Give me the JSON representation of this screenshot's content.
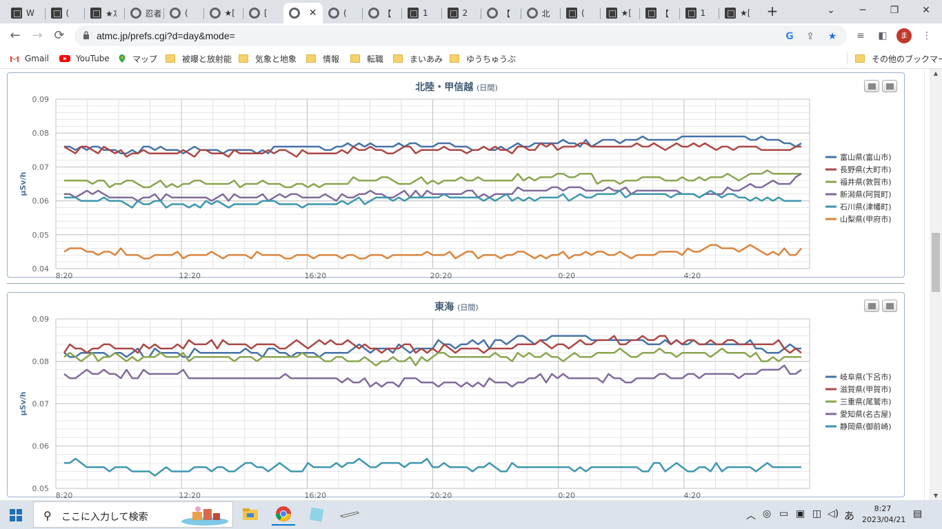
{
  "browser": {
    "tabs": [
      {
        "label": "W",
        "favicon": "site-square-icon"
      },
      {
        "label": "(",
        "favicon": "site-square-icon"
      },
      {
        "label": "★ｽ",
        "favicon": "site-square-icon"
      },
      {
        "label": "忍者",
        "favicon": "globe-icon"
      },
      {
        "label": "(",
        "favicon": "globe-icon"
      },
      {
        "label": "★[",
        "favicon": "globe-icon"
      },
      {
        "label": "[",
        "favicon": "globe-icon"
      },
      {
        "label": "",
        "favicon": "globe-icon",
        "active": true
      },
      {
        "label": "(",
        "favicon": "globe-icon"
      },
      {
        "label": "【",
        "favicon": "globe-icon"
      },
      {
        "label": "1",
        "favicon": "site-square-icon"
      },
      {
        "label": "2",
        "favicon": "site-square-icon"
      },
      {
        "label": "【",
        "favicon": "globe-icon"
      },
      {
        "label": "北",
        "favicon": "globe-icon"
      },
      {
        "label": "(",
        "favicon": "site-square-icon"
      },
      {
        "label": "★[",
        "favicon": "site-square-icon"
      },
      {
        "label": "【",
        "favicon": "site-square-icon"
      },
      {
        "label": "1",
        "favicon": "site-square-icon"
      },
      {
        "label": "★[",
        "favicon": "site-square-icon"
      }
    ],
    "url": "atmc.jp/prefs.cgi?d=day&mode=",
    "profile_initial": "ま",
    "bookmarks": [
      "Gmail",
      "YouTube",
      "マップ",
      "被曝と放射能",
      "気象と地象",
      "情報",
      "転職",
      "まいあみ",
      "ゆうちゅうぶ"
    ],
    "other_bookmarks": "その他のブックマーク"
  },
  "charts": [
    {
      "title": "北陸・甲信越",
      "subtitle": "(日間)",
      "ylabel": "μSv/h",
      "yticks": [
        "0.09",
        "0.08",
        "0.07",
        "0.06",
        "0.05",
        "0.04"
      ],
      "xticks": [
        "8:20",
        "12:20",
        "16:20",
        "20:20",
        "0:20",
        "4:20"
      ],
      "legend": [
        "富山県(富山市)",
        "長野県(大町市)",
        "福井県(敦賀市)",
        "新潟県(阿賀町)",
        "石川県(津幡町)",
        "山梨県(甲府市)"
      ]
    },
    {
      "title": "東海",
      "subtitle": "(日間)",
      "ylabel": "μSv/h",
      "yticks": [
        "0.09",
        "0.08",
        "0.07",
        "0.06",
        "0.05"
      ],
      "xticks": [
        "8:20",
        "12:20",
        "16:20",
        "20:20",
        "0:20",
        "4:20"
      ],
      "legend": [
        "岐阜県(下呂市)",
        "滋賀県(甲賀市)",
        "三重県(尾鷲市)",
        "愛知県(名古屋)",
        "静岡県(御前崎)"
      ]
    }
  ],
  "chart_data": [
    {
      "type": "line",
      "title": "北陸・甲信越",
      "xlabel": "",
      "ylabel": "μSv/h",
      "ylim": [
        0.04,
        0.09
      ],
      "x": [
        "8:20",
        "12:20",
        "16:20",
        "20:20",
        "0:20",
        "4:20"
      ],
      "colors": [
        "#4572a7",
        "#aa4643",
        "#89a54e",
        "#80699b",
        "#3d96ae",
        "#db843d"
      ],
      "series": [
        {
          "name": "富山県(富山市)",
          "values": [
            0.076,
            0.075,
            0.075,
            0.076,
            0.076,
            0.076,
            0.077,
            0.078,
            0.079,
            0.077
          ]
        },
        {
          "name": "長野県(大町市)",
          "values": [
            0.075,
            0.074,
            0.074,
            0.074,
            0.075,
            0.075,
            0.076,
            0.076,
            0.076,
            0.075
          ]
        },
        {
          "name": "福井県(敦賀市)",
          "values": [
            0.066,
            0.065,
            0.065,
            0.065,
            0.066,
            0.066,
            0.067,
            0.066,
            0.067,
            0.068
          ]
        },
        {
          "name": "新潟県(阿賀町)",
          "values": [
            0.062,
            0.061,
            0.061,
            0.061,
            0.062,
            0.062,
            0.063,
            0.063,
            0.062,
            0.067
          ]
        },
        {
          "name": "石川県(津幡町)",
          "values": [
            0.061,
            0.059,
            0.059,
            0.059,
            0.061,
            0.061,
            0.061,
            0.062,
            0.062,
            0.06
          ]
        },
        {
          "name": "山梨県(甲府市)",
          "values": [
            0.046,
            0.044,
            0.044,
            0.044,
            0.044,
            0.044,
            0.044,
            0.044,
            0.046,
            0.045
          ]
        }
      ]
    },
    {
      "type": "line",
      "title": "東海",
      "xlabel": "",
      "ylabel": "μSv/h",
      "ylim": [
        0.05,
        0.09
      ],
      "x": [
        "8:20",
        "12:20",
        "16:20",
        "20:20",
        "0:20",
        "4:20"
      ],
      "colors": [
        "#4572a7",
        "#aa4643",
        "#89a54e",
        "#80699b",
        "#3d96ae"
      ],
      "series": [
        {
          "name": "岐阜県(下呂市)",
          "values": [
            0.082,
            0.082,
            0.082,
            0.082,
            0.083,
            0.084,
            0.086,
            0.085,
            0.084,
            0.083
          ]
        },
        {
          "name": "滋賀県(甲賀市)",
          "values": [
            0.083,
            0.083,
            0.084,
            0.084,
            0.083,
            0.083,
            0.084,
            0.085,
            0.085,
            0.083
          ]
        },
        {
          "name": "三重県(尾鷲市)",
          "values": [
            0.081,
            0.081,
            0.081,
            0.081,
            0.08,
            0.081,
            0.081,
            0.082,
            0.082,
            0.081
          ]
        },
        {
          "name": "愛知県(名古屋)",
          "values": [
            0.077,
            0.077,
            0.076,
            0.076,
            0.075,
            0.075,
            0.076,
            0.076,
            0.077,
            0.078
          ]
        },
        {
          "name": "静岡県(御前崎)",
          "values": [
            0.056,
            0.054,
            0.055,
            0.055,
            0.056,
            0.055,
            0.055,
            0.055,
            0.055,
            0.055
          ]
        }
      ]
    }
  ],
  "taskbar": {
    "search_placeholder": "ここに入力して検索",
    "ime": "あ",
    "time": "8:27",
    "date": "2023/04/21"
  }
}
